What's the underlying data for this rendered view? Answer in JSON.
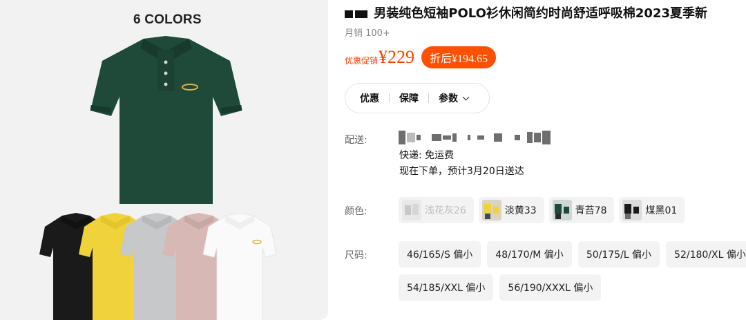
{
  "gallery": {
    "colors_label": "6 COLORS",
    "shirts": [
      {
        "name": "main",
        "color": "#1f4a3a"
      },
      {
        "name": "black",
        "color": "#1a1a1a"
      },
      {
        "name": "yellow",
        "color": "#f0d23a"
      },
      {
        "name": "gray",
        "color": "#c6c8c9"
      },
      {
        "name": "pink",
        "color": "#d7b8b4"
      },
      {
        "name": "white",
        "color": "#f7f7f7"
      }
    ]
  },
  "product": {
    "title": "男装纯色短袖POLO衫休闲简约时尚舒适呼吸棉2023夏季新",
    "sales": "月销 100+",
    "promo_label": "优惠促销",
    "price": "¥229",
    "after_discount": "折后¥194.65"
  },
  "pills": [
    "优惠",
    "保障",
    "参数"
  ],
  "shipping": {
    "label": "配送:",
    "express": "快递: 免运费",
    "eta": "现在下单，预计3月20日送达"
  },
  "color_section": {
    "label": "颜色:",
    "options": [
      {
        "label": "浅花灰26",
        "available": false
      },
      {
        "label": "淡黄33",
        "available": true
      },
      {
        "label": "青苔78",
        "available": true
      },
      {
        "label": "煤黑01",
        "available": true
      }
    ]
  },
  "size_section": {
    "label": "尺码:",
    "row1": [
      "46/165/S 偏小",
      "48/170/M 偏小",
      "50/175/L 偏小",
      "52/180/XL 偏小"
    ],
    "row2": [
      "54/185/XXL 偏小",
      "56/190/XXXL 偏小"
    ]
  },
  "colors": {
    "accent": "#ff5000",
    "price": "#ff4200"
  }
}
